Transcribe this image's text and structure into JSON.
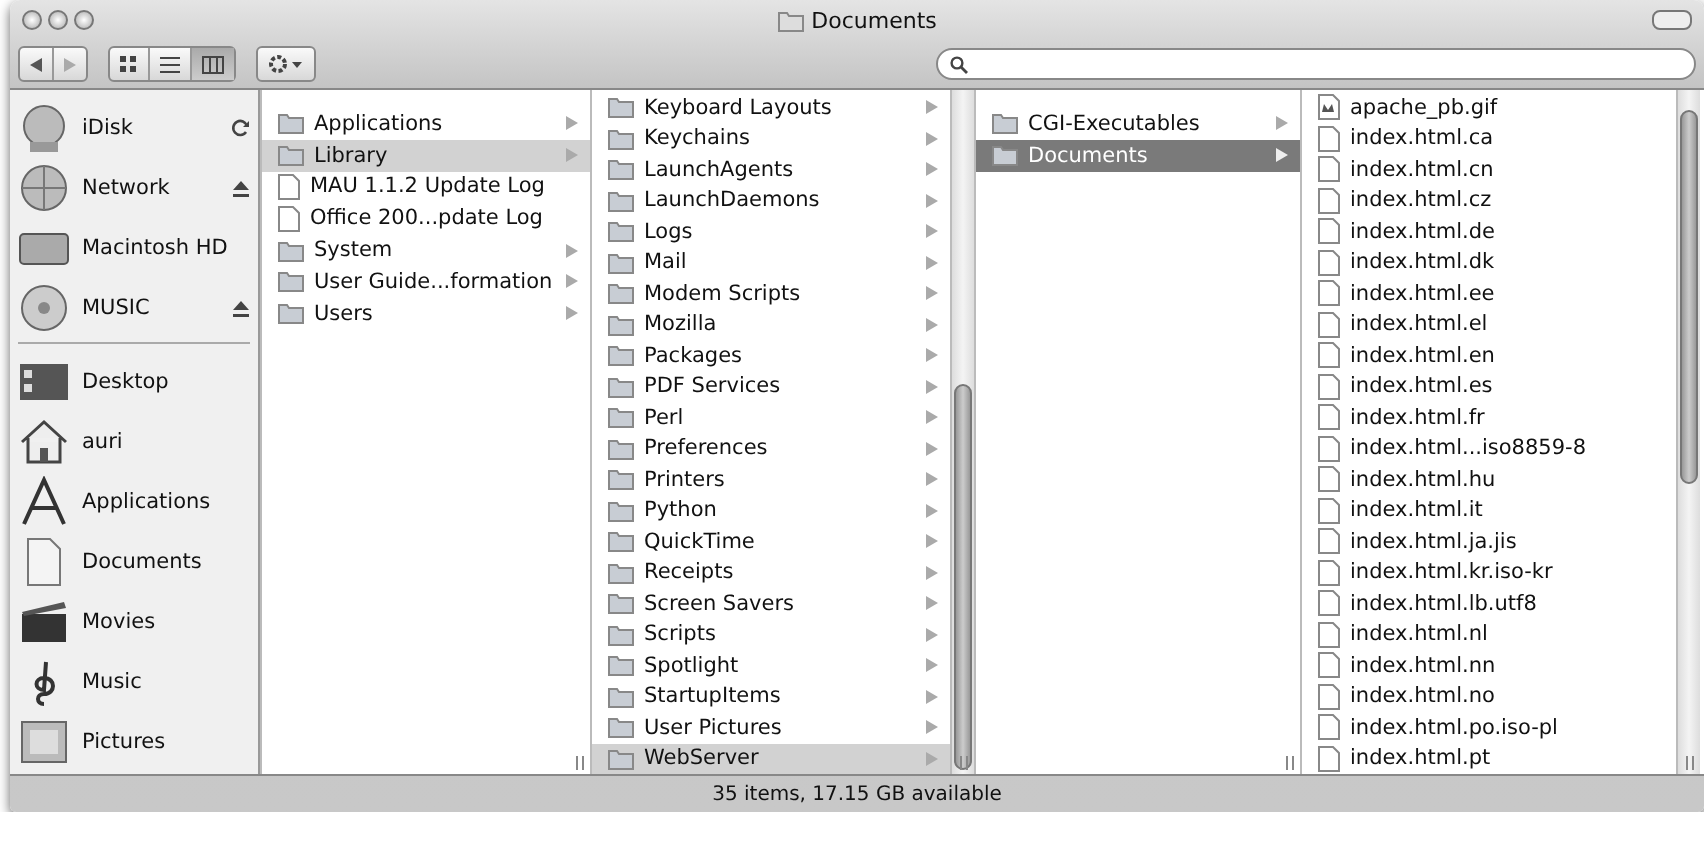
{
  "window": {
    "title": "Documents"
  },
  "toolbar": {
    "views": [
      {
        "kind": "icon",
        "selected": false
      },
      {
        "kind": "list",
        "selected": false
      },
      {
        "kind": "column",
        "selected": true
      }
    ]
  },
  "sidebar": {
    "devices": [
      {
        "label": "iDisk",
        "kind": "idisk",
        "syncing": true,
        "ejectable": false
      },
      {
        "label": "Network",
        "kind": "globe",
        "syncing": false,
        "ejectable": true
      },
      {
        "label": "Macintosh HD",
        "kind": "drive",
        "syncing": false,
        "ejectable": false
      },
      {
        "label": "MUSIC",
        "kind": "disc",
        "syncing": false,
        "ejectable": true
      }
    ],
    "places": [
      {
        "label": "Desktop",
        "kind": "desktop"
      },
      {
        "label": "auri",
        "kind": "home"
      },
      {
        "label": "Applications",
        "kind": "apps"
      },
      {
        "label": "Documents",
        "kind": "document"
      },
      {
        "label": "Movies",
        "kind": "movies"
      },
      {
        "label": "Music",
        "kind": "music"
      },
      {
        "label": "Pictures",
        "kind": "pictures"
      }
    ]
  },
  "columns": [
    {
      "focused": false,
      "scrolled": false,
      "items": [
        {
          "name": "Applications",
          "kind": "folder",
          "has_children": true,
          "selected": false
        },
        {
          "name": "Library",
          "kind": "folder",
          "has_children": true,
          "selected": true
        },
        {
          "name": "MAU 1.1.2 Update Log",
          "kind": "document",
          "has_children": false,
          "selected": false
        },
        {
          "name": "Office 200...pdate Log",
          "kind": "document",
          "has_children": false,
          "selected": false
        },
        {
          "name": "System",
          "kind": "folder",
          "has_children": true,
          "selected": false
        },
        {
          "name": "User Guide...formation",
          "kind": "folder",
          "has_children": true,
          "selected": false
        },
        {
          "name": "Users",
          "kind": "folder",
          "has_children": true,
          "selected": false
        }
      ]
    },
    {
      "focused": false,
      "scrolled": true,
      "items": [
        {
          "name": "Keyboard Layouts",
          "kind": "folder",
          "has_children": true,
          "selected": false
        },
        {
          "name": "Keychains",
          "kind": "folder",
          "has_children": true,
          "selected": false
        },
        {
          "name": "LaunchAgents",
          "kind": "folder",
          "has_children": true,
          "selected": false
        },
        {
          "name": "LaunchDaemons",
          "kind": "folder",
          "has_children": true,
          "selected": false
        },
        {
          "name": "Logs",
          "kind": "folder",
          "has_children": true,
          "selected": false
        },
        {
          "name": "Mail",
          "kind": "folder",
          "has_children": true,
          "selected": false
        },
        {
          "name": "Modem Scripts",
          "kind": "folder",
          "has_children": true,
          "selected": false
        },
        {
          "name": "Mozilla",
          "kind": "folder",
          "has_children": true,
          "selected": false
        },
        {
          "name": "Packages",
          "kind": "folder",
          "has_children": true,
          "selected": false
        },
        {
          "name": "PDF Services",
          "kind": "folder",
          "has_children": true,
          "selected": false
        },
        {
          "name": "Perl",
          "kind": "folder",
          "has_children": true,
          "selected": false
        },
        {
          "name": "Preferences",
          "kind": "folder",
          "has_children": true,
          "selected": false
        },
        {
          "name": "Printers",
          "kind": "folder",
          "has_children": true,
          "selected": false
        },
        {
          "name": "Python",
          "kind": "folder",
          "has_children": true,
          "selected": false
        },
        {
          "name": "QuickTime",
          "kind": "folder",
          "has_children": true,
          "selected": false
        },
        {
          "name": "Receipts",
          "kind": "folder",
          "has_children": true,
          "selected": false
        },
        {
          "name": "Screen Savers",
          "kind": "folder",
          "has_children": true,
          "selected": false
        },
        {
          "name": "Scripts",
          "kind": "folder",
          "has_children": true,
          "selected": false
        },
        {
          "name": "Spotlight",
          "kind": "folder",
          "has_children": true,
          "selected": false
        },
        {
          "name": "StartupItems",
          "kind": "folder",
          "has_children": true,
          "selected": false
        },
        {
          "name": "User Pictures",
          "kind": "folder",
          "has_children": true,
          "selected": false
        },
        {
          "name": "WebServer",
          "kind": "folder",
          "has_children": true,
          "selected": true
        }
      ]
    },
    {
      "focused": true,
      "scrolled": false,
      "items": [
        {
          "name": "CGI-Executables",
          "kind": "folder",
          "has_children": true,
          "selected": false
        },
        {
          "name": "Documents",
          "kind": "folder",
          "has_children": true,
          "selected": true
        }
      ]
    },
    {
      "focused": false,
      "scrolled": true,
      "items": [
        {
          "name": "apache_pb.gif",
          "kind": "image",
          "has_children": false,
          "selected": false
        },
        {
          "name": "index.html.ca",
          "kind": "document",
          "has_children": false,
          "selected": false
        },
        {
          "name": "index.html.cn",
          "kind": "document",
          "has_children": false,
          "selected": false
        },
        {
          "name": "index.html.cz",
          "kind": "document",
          "has_children": false,
          "selected": false
        },
        {
          "name": "index.html.de",
          "kind": "document",
          "has_children": false,
          "selected": false
        },
        {
          "name": "index.html.dk",
          "kind": "document",
          "has_children": false,
          "selected": false
        },
        {
          "name": "index.html.ee",
          "kind": "document",
          "has_children": false,
          "selected": false
        },
        {
          "name": "index.html.el",
          "kind": "document",
          "has_children": false,
          "selected": false
        },
        {
          "name": "index.html.en",
          "kind": "document",
          "has_children": false,
          "selected": false
        },
        {
          "name": "index.html.es",
          "kind": "document",
          "has_children": false,
          "selected": false
        },
        {
          "name": "index.html.fr",
          "kind": "document",
          "has_children": false,
          "selected": false
        },
        {
          "name": "index.html...iso8859-8",
          "kind": "document",
          "has_children": false,
          "selected": false
        },
        {
          "name": "index.html.hu",
          "kind": "document",
          "has_children": false,
          "selected": false
        },
        {
          "name": "index.html.it",
          "kind": "document",
          "has_children": false,
          "selected": false
        },
        {
          "name": "index.html.ja.jis",
          "kind": "document",
          "has_children": false,
          "selected": false
        },
        {
          "name": "index.html.kr.iso-kr",
          "kind": "document",
          "has_children": false,
          "selected": false
        },
        {
          "name": "index.html.lb.utf8",
          "kind": "document",
          "has_children": false,
          "selected": false
        },
        {
          "name": "index.html.nl",
          "kind": "document",
          "has_children": false,
          "selected": false
        },
        {
          "name": "index.html.nn",
          "kind": "document",
          "has_children": false,
          "selected": false
        },
        {
          "name": "index.html.no",
          "kind": "document",
          "has_children": false,
          "selected": false
        },
        {
          "name": "index.html.po.iso-pl",
          "kind": "document",
          "has_children": false,
          "selected": false
        },
        {
          "name": "index.html.pt",
          "kind": "document",
          "has_children": false,
          "selected": false
        }
      ]
    }
  ],
  "status_bar": {
    "text": "35 items, 17.15 GB available"
  }
}
